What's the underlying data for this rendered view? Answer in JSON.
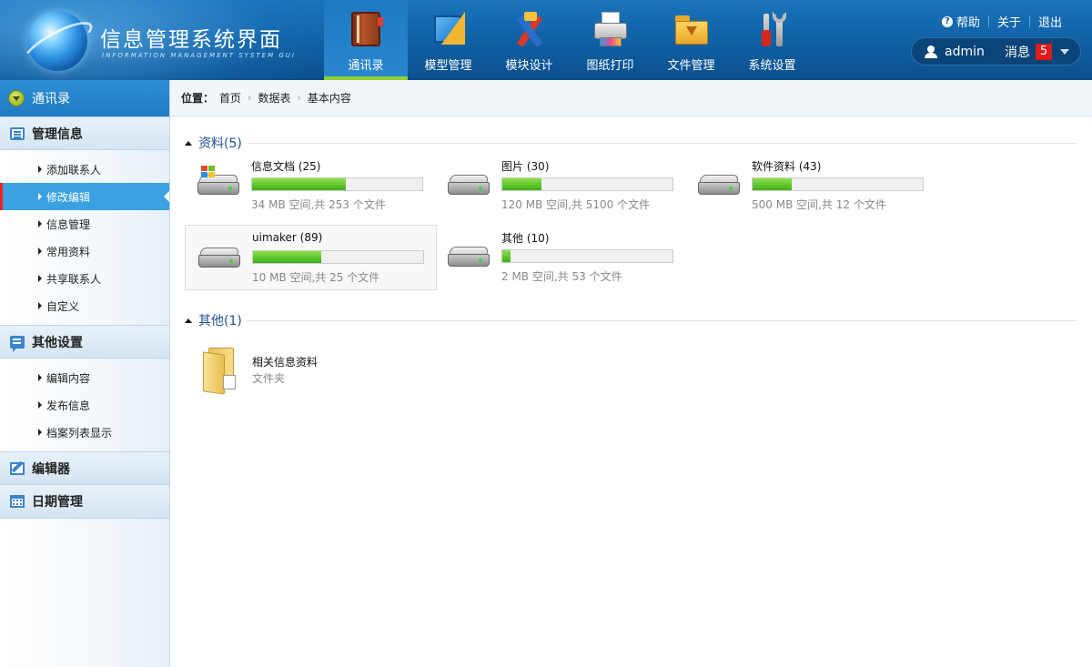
{
  "header": {
    "title": "信息管理系统界面",
    "subtitle": "INFORMATION MANAGEMENT SYSTEM GUI",
    "nav": [
      {
        "label": "通讯录",
        "icon": "address-book-icon",
        "active": true
      },
      {
        "label": "模型管理",
        "icon": "ruler-icon",
        "active": false
      },
      {
        "label": "模块设计",
        "icon": "design-tools-icon",
        "active": false
      },
      {
        "label": "图纸打印",
        "icon": "printer-icon",
        "active": false
      },
      {
        "label": "文件管理",
        "icon": "folder-icon",
        "active": false
      },
      {
        "label": "系统设置",
        "icon": "wrench-icon",
        "active": false
      }
    ],
    "links": {
      "help": "帮助",
      "about": "关于",
      "logout": "退出"
    },
    "user": {
      "name": "admin",
      "messages_label": "消息",
      "message_count": "5"
    }
  },
  "sidebar": {
    "top_label": "通讯录",
    "sections": [
      {
        "title": "管理信息",
        "icon": "list-icon",
        "items": [
          "添加联系人",
          "修改编辑",
          "信息管理",
          "常用资料",
          "共享联系人",
          "自定义"
        ],
        "active_index": 1
      },
      {
        "title": "其他设置",
        "icon": "chat-icon",
        "items": [
          "编辑内容",
          "发布信息",
          "档案列表显示"
        ]
      },
      {
        "title": "编辑器",
        "icon": "edit-icon",
        "items": []
      },
      {
        "title": "日期管理",
        "icon": "calendar-icon",
        "items": []
      }
    ]
  },
  "breadcrumb": {
    "label": "位置：",
    "items": [
      "首页",
      "数据表",
      "基本内容"
    ]
  },
  "groups": [
    {
      "title": "资料(5)"
    },
    {
      "title": "其他(1)"
    }
  ],
  "drives": [
    {
      "name": "信息文档 (25)",
      "info": "34 MB 空间,共 253 个文件",
      "fill_percent": 55,
      "windows": true
    },
    {
      "name": "图片 (30)",
      "info": "120 MB 空间,共 5100 个文件",
      "fill_percent": 23
    },
    {
      "name": "软件资料 (43)",
      "info": "500 MB 空间,共 12 个文件",
      "fill_percent": 23
    },
    {
      "name": "uimaker (89)",
      "info": "10 MB 空间,共 25 个文件",
      "fill_percent": 40
    },
    {
      "name": "其他 (10)",
      "info": "2 MB 空间,共 53 个文件",
      "fill_percent": 5
    }
  ],
  "folder": {
    "name": "相关信息资料",
    "type": "文件夹"
  }
}
